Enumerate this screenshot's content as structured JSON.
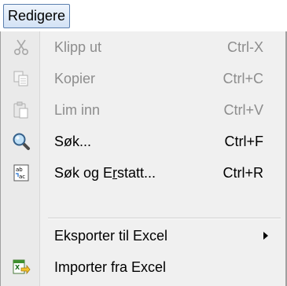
{
  "menubar": {
    "active_menu": "Redigere"
  },
  "menu": {
    "items": [
      {
        "label": "Klipp ut",
        "shortcut": "Ctrl-X",
        "enabled": false,
        "icon": "scissors-icon"
      },
      {
        "label": "Kopier",
        "shortcut": "Ctrl+C",
        "enabled": false,
        "icon": "copy-icon"
      },
      {
        "label": "Lim inn",
        "shortcut": "Ctrl+V",
        "enabled": false,
        "icon": "paste-icon"
      },
      {
        "label": "Søk...",
        "shortcut": "Ctrl+F",
        "enabled": true,
        "icon": "magnifier-icon"
      },
      {
        "label_pre": "Søk og E",
        "label_mn": "r",
        "label_post": "statt...",
        "shortcut": "Ctrl+R",
        "enabled": true,
        "icon": "find-replace-icon"
      },
      {
        "label": "Eksporter til Excel",
        "shortcut": "",
        "enabled": true,
        "has_submenu": true
      },
      {
        "label": "Importer fra Excel",
        "shortcut": "",
        "enabled": true,
        "icon": "excel-import-icon"
      }
    ]
  },
  "colors": {
    "disabled_text": "#8d8d8d",
    "menubar_highlight_border": "#5b7fae",
    "menu_background": "#f0f0f0"
  }
}
